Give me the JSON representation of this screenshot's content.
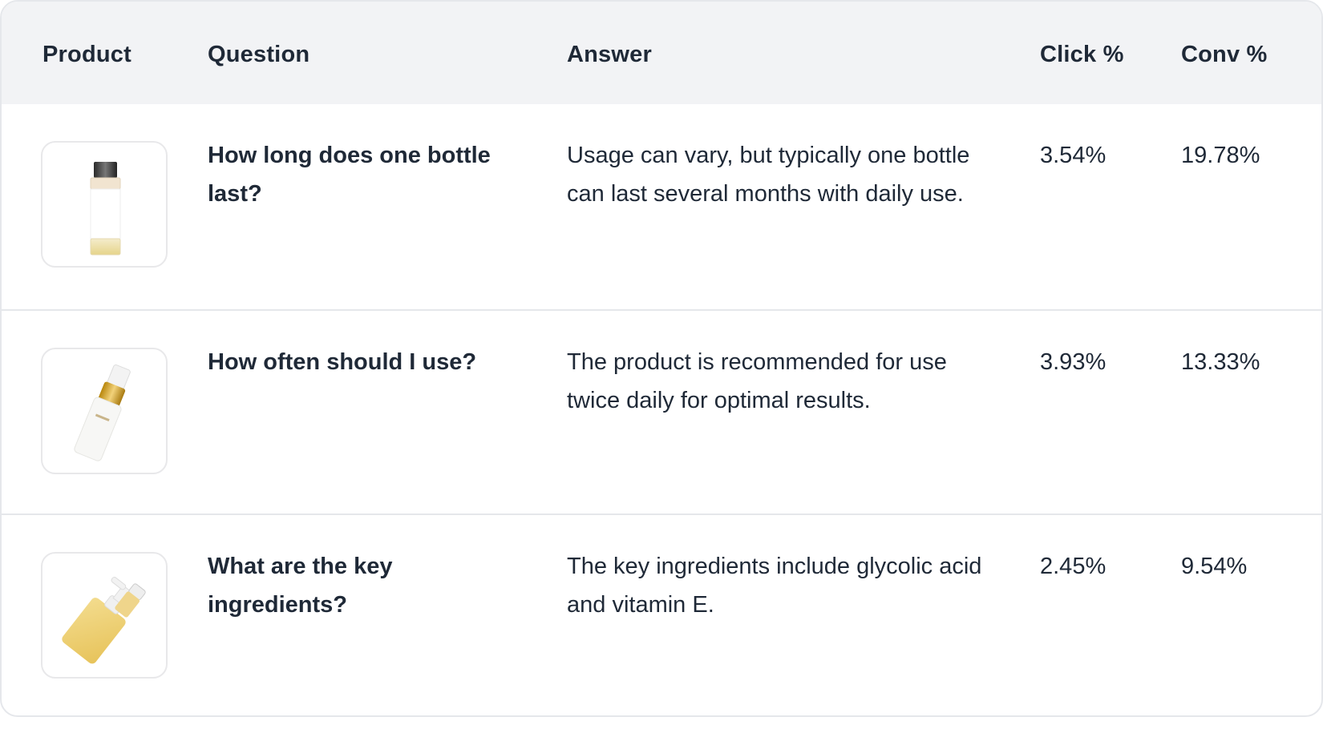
{
  "table": {
    "headers": {
      "product": "Product",
      "question": "Question",
      "answer": "Answer",
      "click": "Click %",
      "conv": "Conv %"
    },
    "rows": [
      {
        "product_image": "clear-glass-bottle-black-cap",
        "question": "How long does one bottle last?",
        "answer": "Usage can vary, but typically one bottle can last several months with daily use.",
        "click_pct": "3.54%",
        "conv_pct": "19.78%"
      },
      {
        "product_image": "white-spray-bottle-gold-pump",
        "question": "How often should I use?",
        "answer": "The product is recommended for use twice daily for optimal results.",
        "click_pct": "3.93%",
        "conv_pct": "13.33%"
      },
      {
        "product_image": "yellow-pump-bottle-and-small-bottle",
        "question": "What are the key ingredients?",
        "answer": "The key ingredients include glycolic acid and vitamin E.",
        "click_pct": "2.45%",
        "conv_pct": "9.54%"
      }
    ]
  },
  "colors": {
    "header_bg": "#f2f3f5",
    "border": "#e5e7eb",
    "text": "#1f2937"
  }
}
